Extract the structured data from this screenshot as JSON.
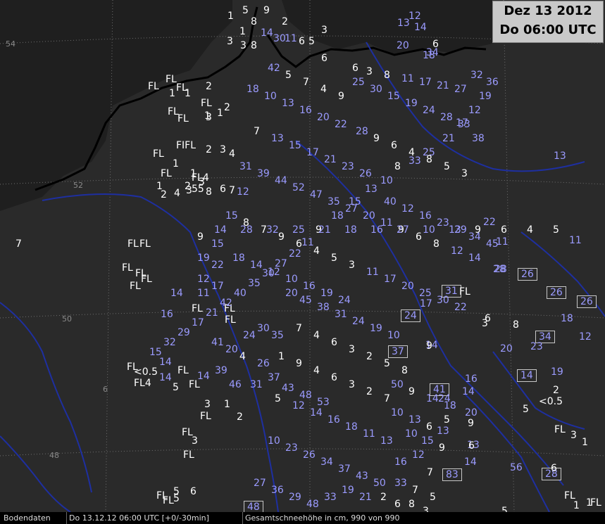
{
  "title": {
    "date": "Dez 13 2012",
    "time": "Do 06:00 UTC"
  },
  "latitudes": [
    "54",
    "52",
    "50",
    "48"
  ],
  "longitudes": [
    "6"
  ],
  "colors": {
    "background": "#2a2a2a",
    "water": "#1e2fa0",
    "coast": "#000000",
    "white_label": "#ffffff",
    "blue_label": "#9b9bff"
  },
  "status": {
    "source": "Bodendaten",
    "time": "Do 13.12.12 06:00 UTC [+0/-30min]",
    "parameter": "Gesamtschneehöhe in cm, 990 von 990"
  },
  "stations": [
    {
      "t": "1",
      "c": "w"
    },
    {
      "t": "5",
      "c": "w"
    },
    {
      "t": "8",
      "c": "w"
    },
    {
      "t": "9",
      "c": "w"
    },
    {
      "t": "1",
      "c": "w"
    },
    {
      "t": "3",
      "c": "w"
    },
    {
      "t": "2",
      "c": "w"
    },
    {
      "t": "3",
      "c": "w"
    },
    {
      "t": "8",
      "c": "w"
    },
    {
      "t": "14",
      "c": "b"
    },
    {
      "t": "30",
      "c": "b"
    },
    {
      "t": "11",
      "c": "b"
    },
    {
      "t": "6",
      "c": "w"
    },
    {
      "t": "5",
      "c": "w"
    },
    {
      "t": "3",
      "c": "w"
    },
    {
      "t": "6",
      "c": "w"
    },
    {
      "t": "12",
      "c": "b"
    },
    {
      "t": "13",
      "c": "b"
    },
    {
      "t": "14",
      "c": "b"
    },
    {
      "t": "6",
      "c": "w"
    },
    {
      "t": "20",
      "c": "b"
    },
    {
      "t": "18",
      "c": "b"
    },
    {
      "t": "34",
      "c": "b"
    },
    {
      "t": "FL",
      "c": "w"
    },
    {
      "t": "1",
      "c": "w"
    },
    {
      "t": "FL",
      "c": "w"
    },
    {
      "t": "2",
      "c": "w"
    },
    {
      "t": "FL",
      "c": "w"
    },
    {
      "t": "1",
      "c": "w"
    },
    {
      "t": "2",
      "c": "w"
    },
    {
      "t": "FL",
      "c": "w"
    },
    {
      "t": "3",
      "c": "w"
    },
    {
      "t": "1",
      "c": "w"
    },
    {
      "t": "FL",
      "c": "w"
    },
    {
      "t": "FL",
      "c": "w"
    },
    {
      "t": "1",
      "c": "w"
    },
    {
      "t": "FL",
      "c": "w"
    },
    {
      "t": "FIFL",
      "c": "w"
    },
    {
      "t": "2",
      "c": "w"
    },
    {
      "t": "3",
      "c": "w"
    },
    {
      "t": "4",
      "c": "w"
    },
    {
      "t": "1",
      "c": "w"
    },
    {
      "t": "FL",
      "c": "w"
    },
    {
      "t": "1",
      "c": "w"
    },
    {
      "t": "FL4",
      "c": "w"
    },
    {
      "t": "2",
      "c": "w"
    },
    {
      "t": "3",
      "c": "w"
    },
    {
      "t": "1",
      "c": "w"
    },
    {
      "t": "2",
      "c": "w"
    },
    {
      "t": "4",
      "c": "w"
    },
    {
      "t": "3",
      "c": "w"
    },
    {
      "t": "55",
      "c": "w"
    },
    {
      "t": "8",
      "c": "w"
    },
    {
      "t": "6",
      "c": "w"
    },
    {
      "t": "7",
      "c": "w"
    },
    {
      "t": "12",
      "c": "b"
    },
    {
      "t": "FL",
      "c": "w"
    },
    {
      "t": "FL",
      "c": "w"
    },
    {
      "t": "FL",
      "c": "w"
    },
    {
      "t": "FL",
      "c": "w"
    },
    {
      "t": "FL",
      "c": "w"
    },
    {
      "t": "FL",
      "c": "w"
    },
    {
      "t": "14",
      "c": "b"
    },
    {
      "t": "16",
      "c": "b"
    },
    {
      "t": "FL",
      "c": "w"
    },
    {
      "t": "FL",
      "c": "w"
    },
    {
      "t": "FL",
      "c": "w"
    },
    {
      "t": "14",
      "c": "b"
    },
    {
      "t": "FL",
      "c": "w"
    },
    {
      "t": "<0.5",
      "c": "w"
    },
    {
      "t": "FL4",
      "c": "w"
    },
    {
      "t": "14",
      "c": "b"
    },
    {
      "t": "5",
      "c": "w"
    },
    {
      "t": "FL",
      "c": "w"
    },
    {
      "t": "14",
      "c": "b"
    },
    {
      "t": "FL",
      "c": "w"
    },
    {
      "t": "3",
      "c": "w"
    },
    {
      "t": "1",
      "c": "w"
    },
    {
      "t": "FL",
      "c": "w"
    },
    {
      "t": "2",
      "c": "w"
    },
    {
      "t": "FL",
      "c": "w"
    },
    {
      "t": "3",
      "c": "w"
    },
    {
      "t": "FL",
      "c": "w"
    },
    {
      "t": "5",
      "c": "w"
    },
    {
      "t": "6",
      "c": "w"
    },
    {
      "t": "5",
      "c": "w"
    },
    {
      "t": "FL",
      "c": "w"
    },
    {
      "t": "FL",
      "c": "w"
    },
    {
      "t": "1",
      "c": "w"
    },
    {
      "t": "FL",
      "c": "w"
    },
    {
      "t": "26",
      "c": "b",
      "box": true
    },
    {
      "t": "26",
      "c": "b",
      "box": true
    },
    {
      "t": "26",
      "c": "b",
      "box": true
    },
    {
      "t": "24",
      "c": "b",
      "box": true
    },
    {
      "t": "31",
      "c": "b",
      "box": true
    },
    {
      "t": "34",
      "c": "b",
      "box": true
    },
    {
      "t": "14",
      "c": "b",
      "box": true
    },
    {
      "t": "41",
      "c": "b",
      "box": true
    },
    {
      "t": "83",
      "c": "b",
      "box": true
    },
    {
      "t": "28",
      "c": "b",
      "box": true
    },
    {
      "t": "48",
      "c": "b",
      "box": true
    },
    {
      "t": "37",
      "c": "b",
      "box": true
    },
    {
      "t": "11",
      "c": "b"
    },
    {
      "t": "28",
      "c": "b"
    },
    {
      "t": "12",
      "c": "b"
    },
    {
      "t": "13",
      "c": "b"
    },
    {
      "t": "18",
      "c": "b"
    },
    {
      "t": "20",
      "c": "b"
    },
    {
      "t": "23",
      "c": "b"
    },
    {
      "t": "14",
      "c": "b"
    },
    {
      "t": "19",
      "c": "b"
    },
    {
      "t": "2",
      "c": "w"
    },
    {
      "t": "<0.5",
      "c": "w"
    },
    {
      "t": "5",
      "c": "w"
    },
    {
      "t": "FL",
      "c": "w"
    },
    {
      "t": "3",
      "c": "w"
    },
    {
      "t": "1",
      "c": "w"
    },
    {
      "t": "56",
      "c": "b"
    },
    {
      "t": "6",
      "c": "w"
    },
    {
      "t": "FL",
      "c": "w"
    },
    {
      "t": "1",
      "c": "w"
    },
    {
      "t": "5",
      "c": "w"
    },
    {
      "t": "14",
      "c": "b"
    },
    {
      "t": "13",
      "c": "b"
    },
    {
      "t": "16",
      "c": "b"
    },
    {
      "t": "22",
      "c": "b"
    },
    {
      "t": "28",
      "c": "b"
    },
    {
      "t": "11",
      "c": "b"
    },
    {
      "t": "17",
      "c": "b"
    },
    {
      "t": "FL",
      "c": "w"
    },
    {
      "t": "6",
      "c": "w"
    },
    {
      "t": "8",
      "c": "w"
    },
    {
      "t": "3",
      "c": "w"
    },
    {
      "t": "6",
      "c": "w"
    },
    {
      "t": "9",
      "c": "w"
    },
    {
      "t": "14",
      "c": "b"
    },
    {
      "t": "24",
      "c": "b"
    },
    {
      "t": "20",
      "c": "b"
    },
    {
      "t": "9",
      "c": "w"
    },
    {
      "t": "5",
      "c": "w"
    },
    {
      "t": "13",
      "c": "b"
    },
    {
      "t": "10",
      "c": "b"
    },
    {
      "t": "15",
      "c": "b"
    },
    {
      "t": "9",
      "c": "w"
    },
    {
      "t": "12",
      "c": "b"
    },
    {
      "t": "7",
      "c": "w"
    },
    {
      "t": "16",
      "c": "b"
    },
    {
      "t": "19",
      "c": "b"
    },
    {
      "t": "12",
      "c": "b"
    },
    {
      "t": "17",
      "c": "b"
    },
    {
      "t": "21",
      "c": "b"
    },
    {
      "t": "25",
      "c": "b"
    },
    {
      "t": "33",
      "c": "b"
    },
    {
      "t": "8",
      "c": "w"
    },
    {
      "t": "10",
      "c": "b"
    },
    {
      "t": "13",
      "c": "b"
    },
    {
      "t": "15",
      "c": "b"
    },
    {
      "t": "18",
      "c": "b"
    },
    {
      "t": "9",
      "c": "w"
    },
    {
      "t": "11",
      "c": "b"
    },
    {
      "t": "22",
      "c": "b"
    },
    {
      "t": "27",
      "c": "b"
    },
    {
      "t": "30",
      "c": "b"
    },
    {
      "t": "35",
      "c": "b"
    },
    {
      "t": "40",
      "c": "b"
    },
    {
      "t": "42",
      "c": "b"
    },
    {
      "t": "21",
      "c": "b"
    },
    {
      "t": "17",
      "c": "b"
    },
    {
      "t": "29",
      "c": "b"
    },
    {
      "t": "32",
      "c": "b"
    },
    {
      "t": "15",
      "c": "b"
    },
    {
      "t": "20",
      "c": "b"
    },
    {
      "t": "45",
      "c": "b"
    },
    {
      "t": "38",
      "c": "b"
    },
    {
      "t": "31",
      "c": "b"
    },
    {
      "t": "24",
      "c": "b"
    },
    {
      "t": "19",
      "c": "b"
    },
    {
      "t": "10",
      "c": "b"
    },
    {
      "t": "7",
      "c": "w"
    },
    {
      "t": "4",
      "c": "w"
    },
    {
      "t": "6",
      "c": "w"
    },
    {
      "t": "3",
      "c": "w"
    },
    {
      "t": "2",
      "c": "w"
    },
    {
      "t": "5",
      "c": "w"
    },
    {
      "t": "8",
      "c": "w"
    },
    {
      "t": "1",
      "c": "w"
    },
    {
      "t": "9",
      "c": "w"
    },
    {
      "t": "4",
      "c": "w"
    },
    {
      "t": "6",
      "c": "w"
    },
    {
      "t": "3",
      "c": "w"
    },
    {
      "t": "2",
      "c": "w"
    },
    {
      "t": "7",
      "c": "w"
    },
    {
      "t": "5",
      "c": "w"
    },
    {
      "t": "12",
      "c": "b"
    },
    {
      "t": "14",
      "c": "b"
    },
    {
      "t": "16",
      "c": "b"
    },
    {
      "t": "18",
      "c": "b"
    },
    {
      "t": "11",
      "c": "b"
    },
    {
      "t": "13",
      "c": "b"
    },
    {
      "t": "10",
      "c": "b"
    },
    {
      "t": "23",
      "c": "b"
    },
    {
      "t": "26",
      "c": "b"
    },
    {
      "t": "34",
      "c": "b"
    },
    {
      "t": "37",
      "c": "b"
    },
    {
      "t": "43",
      "c": "b"
    },
    {
      "t": "50",
      "c": "b"
    },
    {
      "t": "27",
      "c": "b"
    },
    {
      "t": "36",
      "c": "b"
    },
    {
      "t": "29",
      "c": "b"
    },
    {
      "t": "48",
      "c": "b"
    },
    {
      "t": "33",
      "c": "b"
    },
    {
      "t": "19",
      "c": "b"
    },
    {
      "t": "21",
      "c": "b"
    },
    {
      "t": "15",
      "c": "b"
    },
    {
      "t": "8",
      "c": "w"
    },
    {
      "t": "7",
      "c": "w"
    },
    {
      "t": "9",
      "c": "w"
    },
    {
      "t": "6",
      "c": "w"
    },
    {
      "t": "4",
      "c": "w"
    },
    {
      "t": "5",
      "c": "w"
    },
    {
      "t": "3",
      "c": "w"
    },
    {
      "t": "11",
      "c": "b"
    },
    {
      "t": "17",
      "c": "b"
    },
    {
      "t": "20",
      "c": "b"
    },
    {
      "t": "25",
      "c": "b"
    },
    {
      "t": "30",
      "c": "b"
    },
    {
      "t": "22",
      "c": "b"
    },
    {
      "t": "18",
      "c": "b"
    },
    {
      "t": "14",
      "c": "b"
    },
    {
      "t": "12",
      "c": "b"
    },
    {
      "t": "10",
      "c": "b"
    },
    {
      "t": "16",
      "c": "b"
    },
    {
      "t": "19",
      "c": "b"
    },
    {
      "t": "24",
      "c": "b"
    },
    {
      "t": "28",
      "c": "b"
    },
    {
      "t": "9",
      "c": "w"
    },
    {
      "t": "6",
      "c": "w"
    },
    {
      "t": "4",
      "c": "w"
    },
    {
      "t": "8",
      "c": "w"
    },
    {
      "t": "5",
      "c": "w"
    },
    {
      "t": "3",
      "c": "w"
    },
    {
      "t": "7",
      "c": "w"
    },
    {
      "t": "13",
      "c": "b"
    },
    {
      "t": "15",
      "c": "b"
    },
    {
      "t": "17",
      "c": "b"
    },
    {
      "t": "21",
      "c": "b"
    },
    {
      "t": "23",
      "c": "b"
    },
    {
      "t": "26",
      "c": "b"
    },
    {
      "t": "31",
      "c": "b"
    },
    {
      "t": "39",
      "c": "b"
    },
    {
      "t": "44",
      "c": "b"
    },
    {
      "t": "52",
      "c": "b"
    },
    {
      "t": "47",
      "c": "b"
    },
    {
      "t": "35",
      "c": "b"
    },
    {
      "t": "27",
      "c": "b"
    },
    {
      "t": "20",
      "c": "b"
    },
    {
      "t": "11",
      "c": "b"
    },
    {
      "t": "9",
      "c": "w"
    },
    {
      "t": "6",
      "c": "w"
    },
    {
      "t": "8",
      "c": "w"
    },
    {
      "t": "12",
      "c": "b"
    },
    {
      "t": "14",
      "c": "b"
    },
    {
      "t": "18",
      "c": "b"
    },
    {
      "t": "10",
      "c": "b"
    },
    {
      "t": "13",
      "c": "b"
    },
    {
      "t": "16",
      "c": "b"
    },
    {
      "t": "20",
      "c": "b"
    },
    {
      "t": "22",
      "c": "b"
    },
    {
      "t": "25",
      "c": "b"
    },
    {
      "t": "30",
      "c": "b"
    },
    {
      "t": "15",
      "c": "b"
    },
    {
      "t": "19",
      "c": "b"
    },
    {
      "t": "24",
      "c": "b"
    },
    {
      "t": "28",
      "c": "b"
    },
    {
      "t": "33",
      "c": "b"
    },
    {
      "t": "38",
      "c": "b"
    },
    {
      "t": "42",
      "c": "b"
    },
    {
      "t": "5",
      "c": "w"
    },
    {
      "t": "7",
      "c": "w"
    },
    {
      "t": "4",
      "c": "w"
    },
    {
      "t": "9",
      "c": "w"
    },
    {
      "t": "6",
      "c": "w"
    },
    {
      "t": "3",
      "c": "w"
    },
    {
      "t": "8",
      "c": "w"
    },
    {
      "t": "11",
      "c": "b"
    },
    {
      "t": "17",
      "c": "b"
    },
    {
      "t": "21",
      "c": "b"
    },
    {
      "t": "27",
      "c": "b"
    },
    {
      "t": "32",
      "c": "b"
    },
    {
      "t": "36",
      "c": "b"
    },
    {
      "t": "40",
      "c": "b"
    },
    {
      "t": "12",
      "c": "b"
    },
    {
      "t": "16",
      "c": "b"
    },
    {
      "t": "23",
      "c": "b"
    },
    {
      "t": "29",
      "c": "b"
    },
    {
      "t": "34",
      "c": "b"
    },
    {
      "t": "45",
      "c": "b"
    },
    {
      "t": "50",
      "c": "b"
    },
    {
      "t": "9",
      "c": "w"
    },
    {
      "t": "14",
      "c": "b"
    },
    {
      "t": "18",
      "c": "b"
    },
    {
      "t": "10",
      "c": "b"
    },
    {
      "t": "13",
      "c": "b"
    },
    {
      "t": "6",
      "c": "w"
    },
    {
      "t": "4",
      "c": "w"
    },
    {
      "t": "26",
      "c": "b"
    },
    {
      "t": "31",
      "c": "b"
    },
    {
      "t": "37",
      "c": "b"
    },
    {
      "t": "43",
      "c": "b"
    },
    {
      "t": "48",
      "c": "b"
    },
    {
      "t": "53",
      "c": "b"
    },
    {
      "t": "41",
      "c": "b"
    },
    {
      "t": "20",
      "c": "b"
    },
    {
      "t": "24",
      "c": "b"
    },
    {
      "t": "30",
      "c": "b"
    },
    {
      "t": "35",
      "c": "b"
    },
    {
      "t": "39",
      "c": "b"
    },
    {
      "t": "46",
      "c": "b"
    },
    {
      "t": "33",
      "c": "b"
    },
    {
      "t": "7",
      "c": "w"
    },
    {
      "t": "5",
      "c": "w"
    },
    {
      "t": "8",
      "c": "w"
    },
    {
      "t": "3",
      "c": "w"
    },
    {
      "t": "6",
      "c": "w"
    },
    {
      "t": "2",
      "c": "w"
    },
    {
      "t": "9",
      "c": "w"
    },
    {
      "t": "15",
      "c": "b"
    },
    {
      "t": "19",
      "c": "b"
    },
    {
      "t": "22",
      "c": "b"
    },
    {
      "t": "12",
      "c": "b"
    },
    {
      "t": "17",
      "c": "b"
    },
    {
      "t": "11",
      "c": "b"
    },
    {
      "t": "14",
      "c": "b"
    },
    {
      "t": "28",
      "c": "b"
    },
    {
      "t": "32",
      "c": "b"
    },
    {
      "t": "25",
      "c": "b"
    },
    {
      "t": "21",
      "c": "b"
    },
    {
      "t": "18",
      "c": "b"
    },
    {
      "t": "16",
      "c": "b"
    },
    {
      "t": "27",
      "c": "b"
    },
    {
      "t": "10",
      "c": "b"
    },
    {
      "t": "13",
      "c": "b"
    },
    {
      "t": "9",
      "c": "w"
    },
    {
      "t": "6",
      "c": "w"
    },
    {
      "t": "4",
      "c": "w"
    },
    {
      "t": "5",
      "c": "w"
    },
    {
      "t": "7",
      "c": "w"
    }
  ]
}
